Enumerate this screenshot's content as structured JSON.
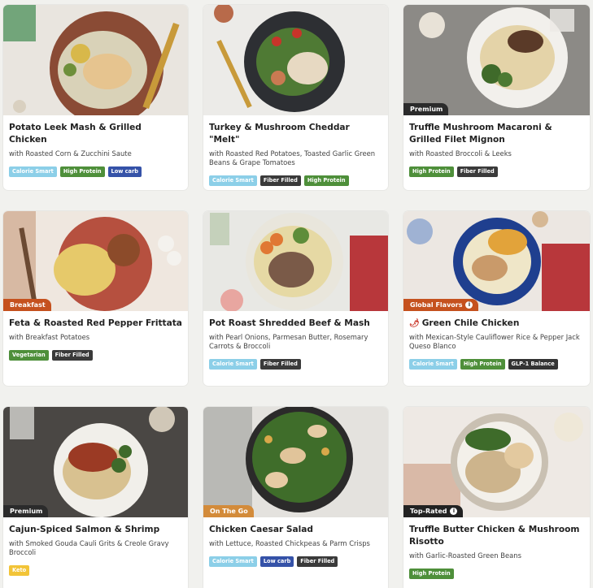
{
  "colors": {
    "calorie_smart": "#8ccfe8",
    "high_protein": "#4e8f3a",
    "low_carb": "#3552a8",
    "fiber_filled": "#3a3a3a",
    "vegetarian": "#4e8f3a",
    "keto": "#f2c438",
    "glp1": "#333333",
    "ribbon_premium": "#2b2b2b",
    "ribbon_breakfast": "#c5511e",
    "ribbon_global": "#c5511e",
    "ribbon_onthego": "#d38b3a",
    "ribbon_toprated": "#222222"
  },
  "meals": [
    {
      "title": "Potato Leek Mash & Grilled Chicken",
      "subtitle": "with Roasted Corn & Zucchini Saute",
      "ribbon": "",
      "tags": [
        "Calorie Smart",
        "High Protein",
        "Low carb"
      ]
    },
    {
      "title": "Turkey & Mushroom Cheddar \"Melt\"",
      "subtitle": "with Roasted Red Potatoes, Toasted Garlic Green Beans & Grape Tomatoes",
      "ribbon": "",
      "tags": [
        "Calorie Smart",
        "Fiber Filled",
        "High Protein"
      ]
    },
    {
      "title": "Truffle Mushroom Macaroni & Grilled Filet Mignon",
      "subtitle": "with Roasted Broccoli & Leeks",
      "ribbon": "Premium",
      "tags": [
        "High Protein",
        "Fiber Filled"
      ]
    },
    {
      "title": "Feta & Roasted Red Pepper Frittata",
      "subtitle": "with Breakfast Potatoes",
      "ribbon": "Breakfast",
      "tags": [
        "Vegetarian",
        "Fiber Filled"
      ]
    },
    {
      "title": "Pot Roast Shredded Beef & Mash",
      "subtitle": "with Pearl Onions, Parmesan Butter, Rosemary Carrots & Broccoli",
      "ribbon": "",
      "tags": [
        "Calorie Smart",
        "Fiber Filled"
      ]
    },
    {
      "title": "Green Chile Chicken",
      "subtitle": "with Mexican-Style Cauliflower Rice & Pepper Jack Queso Blanco",
      "ribbon": "Global Flavors",
      "tags": [
        "Calorie Smart",
        "High Protein",
        "GLP-1 Balance"
      ]
    },
    {
      "title": "Cajun-Spiced Salmon & Shrimp",
      "subtitle": "with Smoked Gouda Cauli Grits & Creole Gravy Broccoli",
      "ribbon": "Premium",
      "tags": [
        "Keto"
      ]
    },
    {
      "title": "Chicken Caesar Salad",
      "subtitle": "with Lettuce, Roasted Chickpeas & Parm Crisps",
      "ribbon": "On The Go",
      "tags": [
        "Calorie Smart",
        "Low carb",
        "Fiber Filled"
      ]
    },
    {
      "title": "Truffle Butter Chicken & Mushroom Risotto",
      "subtitle": "with Garlic-Roasted Green Beans",
      "ribbon": "Top-Rated",
      "tags": [
        "High Protein"
      ]
    }
  ]
}
